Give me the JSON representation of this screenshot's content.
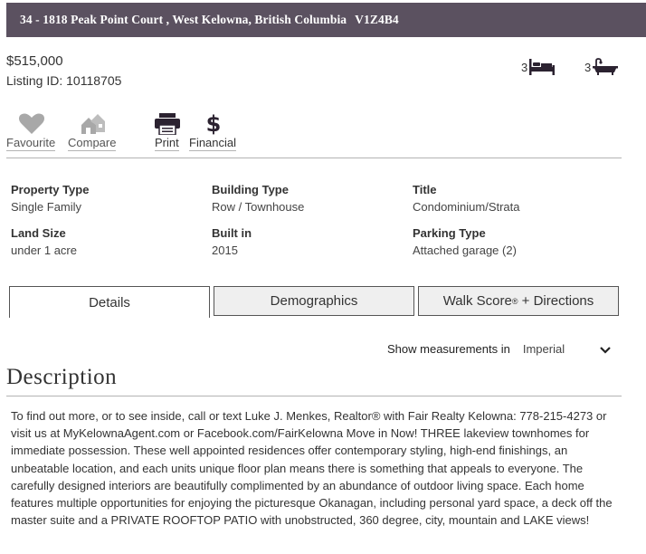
{
  "header": {
    "address": "34 - 1818 Peak Point Court , West Kelowna, British Columbia",
    "postal_code": "V1Z4B4"
  },
  "summary": {
    "price": "$515,000",
    "listing_id": "Listing ID: 10118705",
    "bedrooms": "3",
    "bathrooms": "3"
  },
  "actions": [
    {
      "label": "Favourite",
      "icon": "heart-icon"
    },
    {
      "label": "Compare",
      "icon": "houses-icon"
    },
    {
      "label": "Print",
      "icon": "printer-icon"
    },
    {
      "label": "Financial",
      "icon": "dollar-icon"
    }
  ],
  "properties": [
    {
      "key": "Property Type",
      "value": "Single Family"
    },
    {
      "key": "Building Type",
      "value": "Row / Townhouse"
    },
    {
      "key": "Title",
      "value": "Condominium/Strata"
    },
    {
      "key": "Land Size",
      "value": "under 1 acre"
    },
    {
      "key": "Built in",
      "value": "2015"
    },
    {
      "key": "Parking Type",
      "value": "Attached garage (2)"
    }
  ],
  "tabs": [
    {
      "label": "Details",
      "active": true
    },
    {
      "label": "Demographics",
      "active": false
    },
    {
      "label": "Walk Score",
      "suffix": " + Directions",
      "sup": "®",
      "active": false
    }
  ],
  "measurements": {
    "label": "Show measurements in",
    "selected": "Imperial"
  },
  "description": {
    "title": "Description",
    "body": "To find out more, or to see inside, call or text Luke J. Menkes, Realtor® with Fair Realty Kelowna: 778-215-4273 or visit us at MyKelownaAgent.com or Facebook.com/FairKelowna Move in Now! THREE lakeview townhomes for immediate possession. These well appointed residences offer contemporary styling, high-end finishings, an unbeatable location, and each units unique floor plan means there is something that appeals to everyone. The carefully designed interiors are beautifully complimented by an abundance of outdoor living space. Each home features multiple opportunities for enjoying the picturesque Okanagan, including personal yard space, a deck off the master suite and a PRIVATE ROOFTOP PATIO with unobstructed, 360 degree, city, mountain and LAKE views!"
  },
  "colors": {
    "header_bg": "#5b5160",
    "muted_icon": "#a8a8a8",
    "dark_icon": "#2b2230"
  }
}
